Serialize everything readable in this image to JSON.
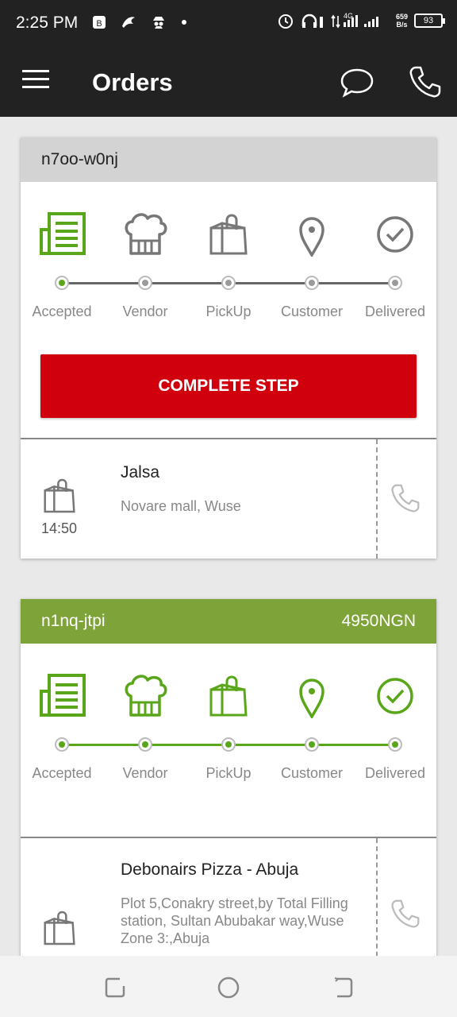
{
  "status_bar": {
    "time": "2:25 PM",
    "left_icons": [
      "notification-icon",
      "bird-icon",
      "spy-icon",
      "dot-icon"
    ],
    "network_label": "4G",
    "net_speed": "659",
    "net_speed_unit": "B/s",
    "battery": "93"
  },
  "app_bar": {
    "title": "Orders",
    "icons": [
      "menu-icon",
      "chat-icon",
      "phone-icon"
    ]
  },
  "step_labels": [
    "Accepted",
    "Vendor",
    "PickUp",
    "Customer",
    "Delivered"
  ],
  "step_icons": [
    "receipt-icon",
    "chef-hat-icon",
    "shopping-bag-icon",
    "location-pin-icon",
    "check-circle-icon"
  ],
  "orders": [
    {
      "id": "n7oo-w0nj",
      "amount": "",
      "completed_steps": 1,
      "button_label": "COMPLETE STEP",
      "vendor": {
        "name": "Jalsa",
        "address": "Novare mall, Wuse",
        "time": "14:50"
      }
    },
    {
      "id": "n1nq-jtpi",
      "amount": "4950NGN",
      "completed_steps": 5,
      "button_label": "",
      "vendor": {
        "name": "Debonairs Pizza - Abuja",
        "address": "Plot 5,Conakry street,by Total Filling station, Sultan Abubakar way,Wuse Zone 3:,Abuja",
        "time": ""
      }
    }
  ],
  "colors": {
    "bar": "#222222",
    "green": "#5aa61b",
    "header_green": "#7ea338",
    "header_grey": "#d3d3d3",
    "button_red": "#d0000d"
  },
  "nav_icons": [
    "recent-apps-icon",
    "home-icon",
    "back-icon"
  ]
}
